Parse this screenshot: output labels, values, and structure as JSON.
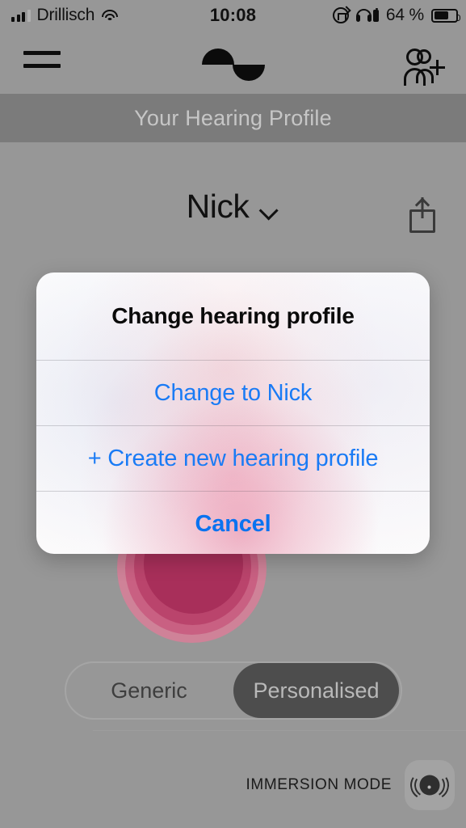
{
  "status_bar": {
    "carrier": "Drillisch",
    "time": "10:08",
    "battery_percent": "64 %",
    "icons": {
      "signal": "signal-bars-icon",
      "wifi": "wifi-icon",
      "rotation_lock": "rotation-lock-icon",
      "headphones": "headphones-battery-icon",
      "battery": "battery-icon"
    }
  },
  "navbar": {
    "menu_icon": "hamburger-menu-icon",
    "logo_icon": "sine-wave-logo-icon",
    "add_person_icon": "add-person-icon"
  },
  "banner": {
    "title": "Your Hearing Profile"
  },
  "profile": {
    "name": "Nick",
    "chevron_icon": "chevron-down-icon",
    "share_icon": "share-icon"
  },
  "dialog": {
    "title": "Change hearing profile",
    "actions": [
      {
        "label": "Change to Nick",
        "style": "normal"
      },
      {
        "label": "+ Create new hearing profile",
        "style": "normal"
      },
      {
        "label": "Cancel",
        "style": "bold"
      }
    ],
    "accent_color": "#1a7bf5"
  },
  "mode_toggle": {
    "options": [
      {
        "label": "Generic",
        "selected": false
      },
      {
        "label": "Personalised",
        "selected": true
      }
    ],
    "selected_bg": "#4d4d4d"
  },
  "immersion": {
    "label": "IMMERSION MODE",
    "button_icon": "immersion-speaker-icon"
  },
  "colors": {
    "app_background": "#979797",
    "banner_background": "#7b7b7b",
    "blob_pink": "#a62e5a",
    "link_blue": "#1a7bf5"
  }
}
